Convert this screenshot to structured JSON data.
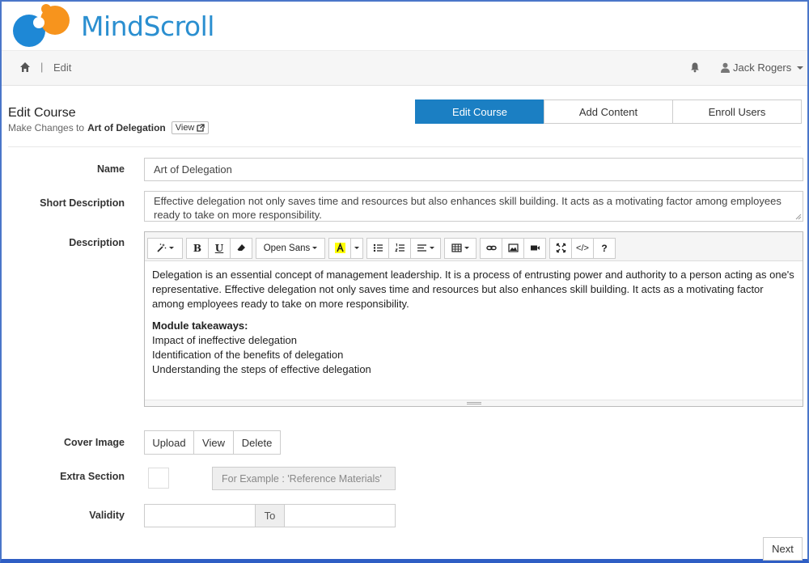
{
  "app": {
    "name": "MindScroll"
  },
  "nav": {
    "breadcrumb_sep": "|",
    "current": "Edit",
    "user": "Jack Rogers"
  },
  "header": {
    "title": "Edit Course",
    "subtitle_prefix": "Make Changes to",
    "course_name": "Art of Delegation",
    "view_label": "View"
  },
  "tabs": [
    {
      "label": "Edit Course",
      "active": true
    },
    {
      "label": "Add Content",
      "active": false
    },
    {
      "label": "Enroll Users",
      "active": false
    }
  ],
  "form": {
    "name_label": "Name",
    "name_value": "Art of Delegation",
    "short_desc_label": "Short Description",
    "short_desc_value": "Effective delegation not only saves time and resources but also enhances skill building. It acts as a motivating factor among employees ready to take on more responsibility.",
    "description_label": "Description",
    "description": {
      "paragraph": "Delegation is an essential concept of management leadership. It is a process of entrusting power and authority to a person acting as one's representative. Effective delegation not only saves time and resources but also enhances skill building. It acts as a motivating factor among employees ready to take on more responsibility.",
      "takeaways_title": "Module takeaways:",
      "takeaways": [
        "Impact of ineffective delegation",
        "Identification of the benefits of delegation",
        "Understanding the steps of effective delegation"
      ]
    },
    "cover_image_label": "Cover Image",
    "cover_buttons": [
      "Upload",
      "View",
      "Delete"
    ],
    "extra_section_label": "Extra Section",
    "extra_section_placeholder": "For Example : 'Reference Materials'",
    "validity_label": "Validity",
    "validity_from": "",
    "validity_to_label": "To",
    "validity_to": "",
    "next_label": "Next"
  },
  "editor_toolbar": {
    "font_name": "Open Sans",
    "bold": "B",
    "underline": "U",
    "help": "?",
    "code": "</>"
  },
  "colors": {
    "accent": "#1b7fc3",
    "logo_blue": "#2b8fd0",
    "logo_orange": "#f7941d"
  }
}
